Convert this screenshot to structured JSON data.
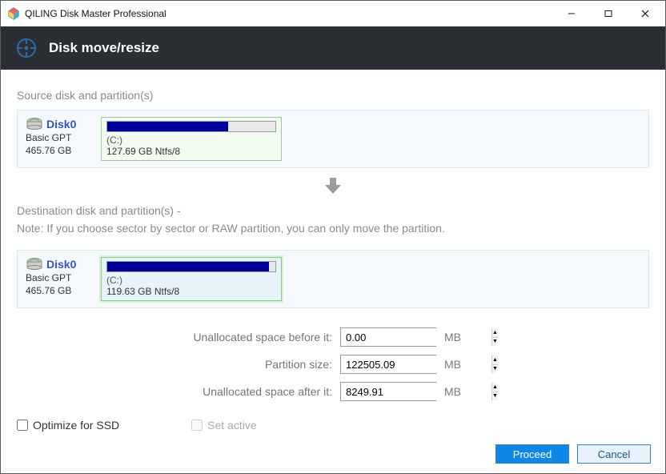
{
  "window": {
    "title": "QILING Disk Master Professional"
  },
  "header": {
    "title": "Disk move/resize"
  },
  "source": {
    "label": "Source disk and partition(s)",
    "disk": {
      "name": "Disk0",
      "type": "Basic GPT",
      "size": "465.76 GB"
    },
    "partition": {
      "letter": "(C:)",
      "desc": "127.69 GB Ntfs/8",
      "fill_pct": 72
    }
  },
  "arrow": "▼",
  "destination": {
    "label": "Destination disk and partition(s) -",
    "note": "Note: If you choose sector by sector or RAW partition, you can only move the partition.",
    "disk": {
      "name": "Disk0",
      "type": "Basic GPT",
      "size": "465.76 GB"
    },
    "partition": {
      "letter": "(C:)",
      "desc": "119.63 GB Ntfs/8",
      "fill_pct": 96
    }
  },
  "form": {
    "unalloc_before": {
      "label": "Unallocated space before it:",
      "value": "0.00",
      "unit": "MB"
    },
    "partition_size": {
      "label": "Partition size:",
      "value": "122505.09",
      "unit": "MB"
    },
    "unalloc_after": {
      "label": "Unallocated space after it:",
      "value": "8249.91",
      "unit": "MB"
    }
  },
  "options": {
    "optimize_ssd": {
      "label": "Optimize for SSD",
      "checked": false
    },
    "set_active": {
      "label": "Set active",
      "checked": false,
      "disabled": true
    }
  },
  "footer": {
    "proceed": "Proceed",
    "cancel": "Cancel"
  }
}
